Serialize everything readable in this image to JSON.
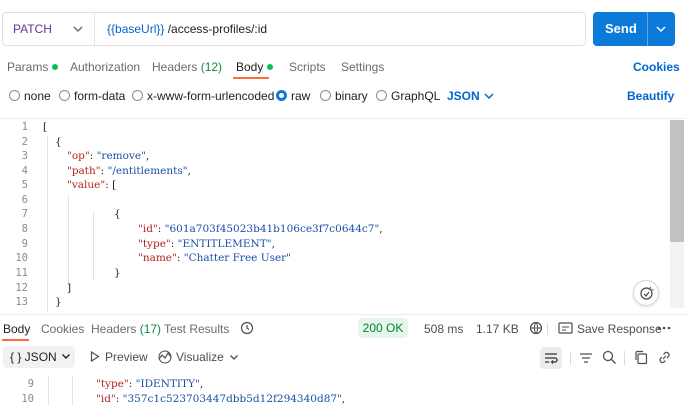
{
  "request": {
    "method": "PATCH",
    "url_variable": "{{baseUrl}}",
    "url_path": " /access-profiles/:id",
    "send_label": "Send"
  },
  "request_tabs": {
    "params": "Params",
    "authorization": "Authorization",
    "headers": "Headers",
    "headers_count": "(12)",
    "body": "Body",
    "scripts": "Scripts",
    "settings": "Settings",
    "cookies": "Cookies"
  },
  "body_types": {
    "none": "none",
    "form_data": "form-data",
    "urlencoded": "x-www-form-urlencoded",
    "raw": "raw",
    "binary": "binary",
    "graphql": "GraphQL",
    "selected": "raw",
    "language": "JSON",
    "beautify": "Beautify"
  },
  "editor": {
    "line_numbers": [
      "1",
      "2",
      "3",
      "4",
      "5",
      "6",
      "7",
      "8",
      "9",
      "10",
      "11",
      "12",
      "13"
    ],
    "lines": {
      "l1": "[",
      "l2": "{",
      "l3_key": "\"op\"",
      "l3_val": "\"remove\"",
      "l4_key": "\"path\"",
      "l4_val": "\"/entitlements\"",
      "l5_key": "\"value\"",
      "l5_rest": ": [",
      "l7": "{",
      "l8_key": "\"id\"",
      "l8_val": "\"601a703f45023b41b106ce3f7c0644c7\"",
      "l9_key": "\"type\"",
      "l9_val": "\"ENTITLEMENT\"",
      "l10_key": "\"name\"",
      "l10_val": "\"Chatter Free User\"",
      "l11": "}",
      "l12": "]",
      "l13": "}"
    }
  },
  "response_tabs": {
    "body": "Body",
    "cookies": "Cookies",
    "headers": "Headers",
    "headers_count": "(17)",
    "test_results": "Test Results"
  },
  "response_meta": {
    "status": "200 OK",
    "time": "508 ms",
    "size": "1.17 KB",
    "save_response": "Save Response",
    "status_color": "#0a7d33"
  },
  "response_toolbar": {
    "format": "{ } JSON",
    "preview": "Preview",
    "visualize": "Visualize"
  },
  "response_code": {
    "line_numbers": [
      "9",
      "10"
    ],
    "l9_key": "\"type\"",
    "l9_val": "\"IDENTITY\"",
    "l10_key": "\"id\"",
    "l10_val": "\"357c1c523703447dbb5d12f294340d87\""
  },
  "colors": {
    "accent": "#0b7ad8",
    "tab_indicator": "#ff6c37",
    "method": "#623497",
    "json_key": "#b5221f",
    "json_string": "#1a4fa8"
  },
  "icons": [
    "chevron-down-icon",
    "history-icon",
    "globe-icon",
    "save-icon",
    "play-icon",
    "visualize-icon",
    "wrap-lines-icon",
    "filter-icon",
    "search-icon",
    "copy-icon",
    "link-icon",
    "magic-icon"
  ]
}
